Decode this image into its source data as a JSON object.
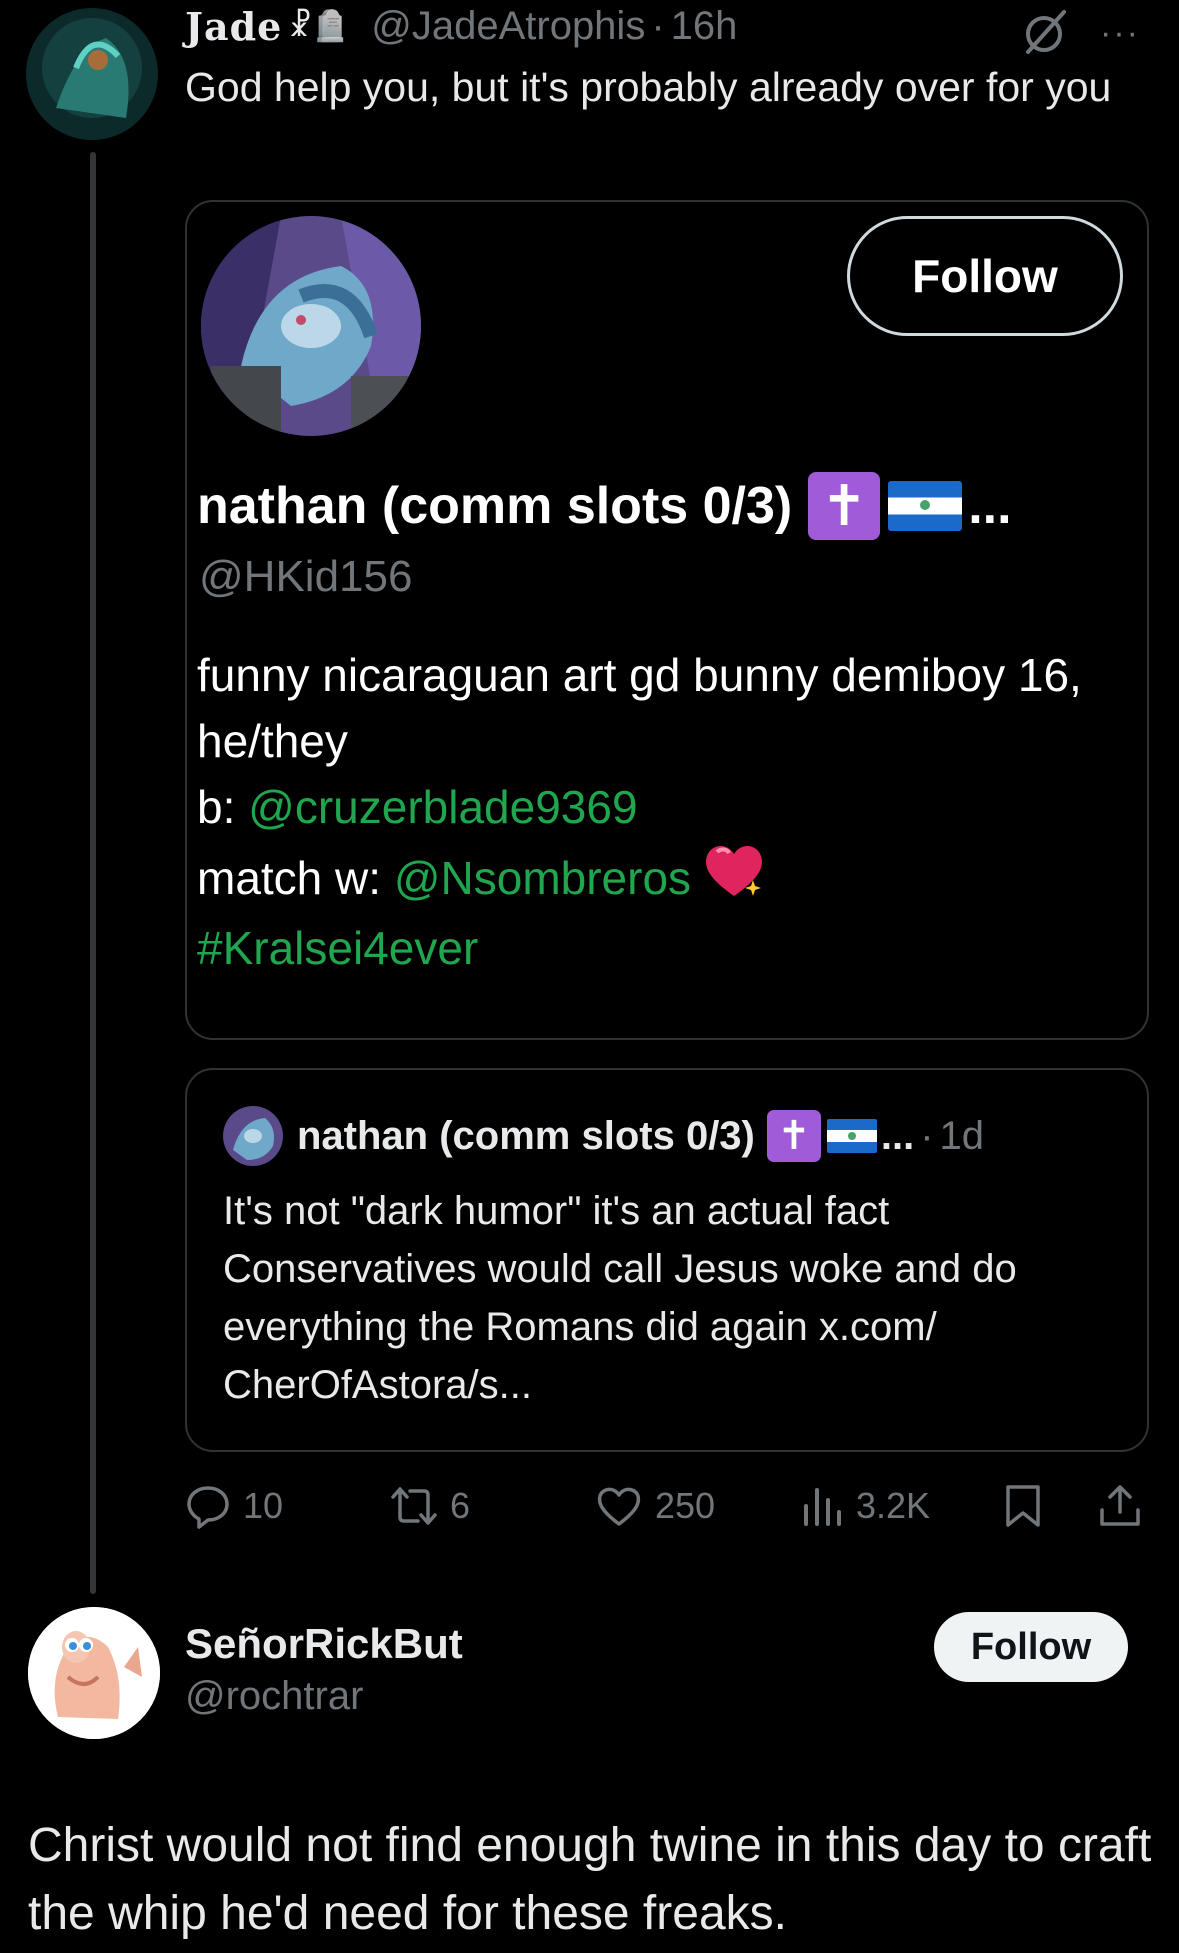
{
  "post1": {
    "author_name": "Jade",
    "author_name_icons": "☧🪦",
    "handle": "@JadeAtrophis",
    "time": "16h",
    "more": "···",
    "text": "God help you, but it's probably already over for you",
    "profile_card": {
      "follow_label": "Follow",
      "name": "nathan (comm slots 0/3)",
      "cross": "✝",
      "ellipsis": "...",
      "handle": "@HKid156",
      "bio_line1": "funny nicaraguan art gd bunny demiboy 16, he/they",
      "bio_b_prefix": "b: ",
      "bio_b_link": "@cruzerblade9369",
      "bio_match_prefix": "match w: ",
      "bio_match_link": "@Nsombreros",
      "bio_hashtag": "#Kralsei4ever"
    },
    "quote": {
      "name": "nathan (comm slots 0/3)",
      "cross": "✝",
      "ellipsis": "...",
      "time": "1d",
      "text": "It's not \"dark humor\" it's an actual fact Conservatives would call Jesus woke and do everything the Romans did again x.com/ CherOfAstora/s..."
    },
    "actions": {
      "replies": "10",
      "reposts": "6",
      "likes": "250",
      "views": "3.2K"
    }
  },
  "post2": {
    "author_name": "SeñorRickBut",
    "handle": "@rochtrar",
    "follow_label": "Follow",
    "text": "Christ would not find enough twine in this day to craft the whip he'd need for these freaks."
  },
  "colors": {
    "background": "#000000",
    "text": "#e7e9ea",
    "muted": "#71767b",
    "link": "#1fa64f",
    "border": "#2f3336",
    "badge_purple": "#a05bd8"
  }
}
